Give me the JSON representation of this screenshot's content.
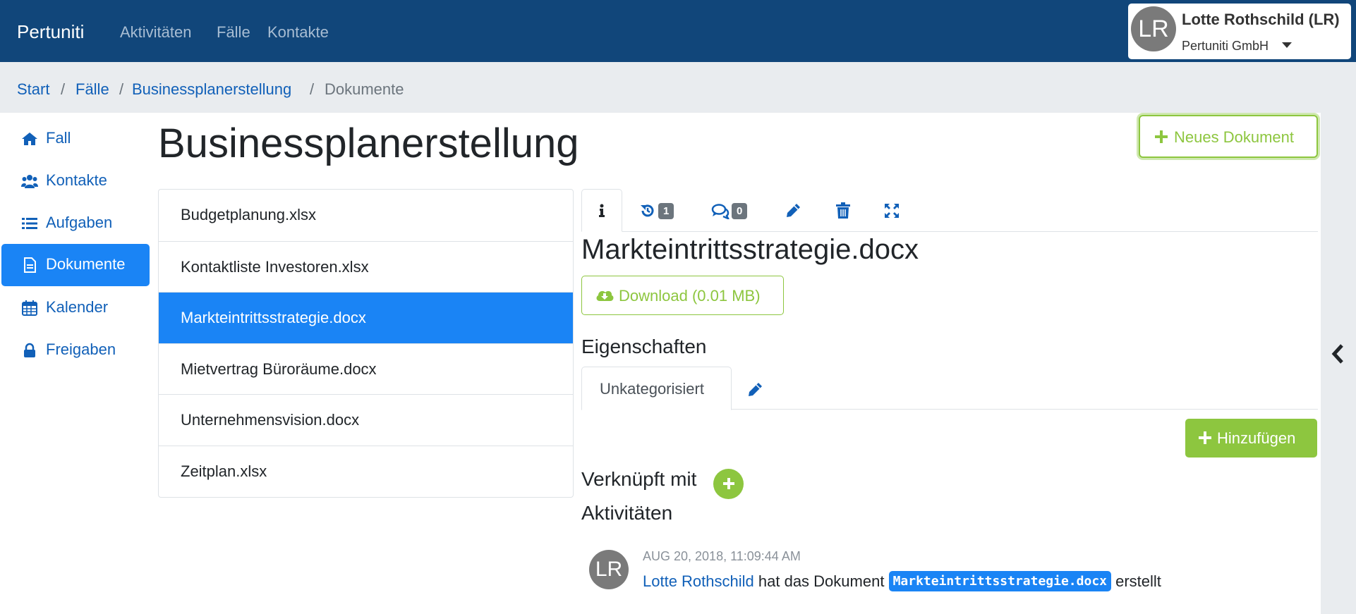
{
  "navbar": {
    "brand": "Pertuniti",
    "links": [
      "Aktivitäten",
      "Fälle",
      "Kontakte"
    ],
    "user": {
      "initials": "LR",
      "name": "Lotte Rothschild (LR)",
      "company": "Pertuniti GmbH"
    },
    "background": "#11467a"
  },
  "breadcrumb": [
    "Start",
    "Fälle",
    "Businessplanerstellung",
    "Dokumente"
  ],
  "sidebar": {
    "items": [
      {
        "label": "Fall",
        "icon": "home-icon"
      },
      {
        "label": "Kontakte",
        "icon": "users-icon"
      },
      {
        "label": "Aufgaben",
        "icon": "list-icon"
      },
      {
        "label": "Dokumente",
        "icon": "file-icon",
        "active": true
      },
      {
        "label": "Kalender",
        "icon": "calendar-icon"
      },
      {
        "label": "Freigaben",
        "icon": "lock-icon"
      }
    ]
  },
  "main": {
    "title": "Businessplanerstellung",
    "new_document_label": "Neues Dokument",
    "documents": [
      "Budgetplanung.xlsx",
      "Kontaktliste Investoren.xlsx",
      "Markteintrittsstrategie.docx",
      "Mietvertrag Büroräume.docx",
      "Unternehmensvision.docx",
      "Zeitplan.xlsx"
    ],
    "selected_document_index": 2
  },
  "detail": {
    "tabs": {
      "history_count": "1",
      "comments_count": "0"
    },
    "doc_title": "Markteintrittsstrategie.docx",
    "download_label": "Download (0.01 MB)",
    "properties_heading": "Eigenschaften",
    "category_tab": "Unkategorisiert",
    "add_label": "Hinzufügen",
    "linked_heading": "Verknüpft mit",
    "activities_heading": "Aktivitäten",
    "activity": {
      "initials": "LR",
      "timestamp": "AUG 20, 2018, 11:09:44 AM",
      "user": "Lotte Rothschild",
      "text_mid": "hat das Dokument",
      "doc": "Markteintrittsstrategie.docx",
      "text_end": "erstellt"
    }
  },
  "colors": {
    "primary": "#1a84f5",
    "link": "#1160b8",
    "success": "#8dc63f",
    "badge_gray": "#6c757d"
  }
}
